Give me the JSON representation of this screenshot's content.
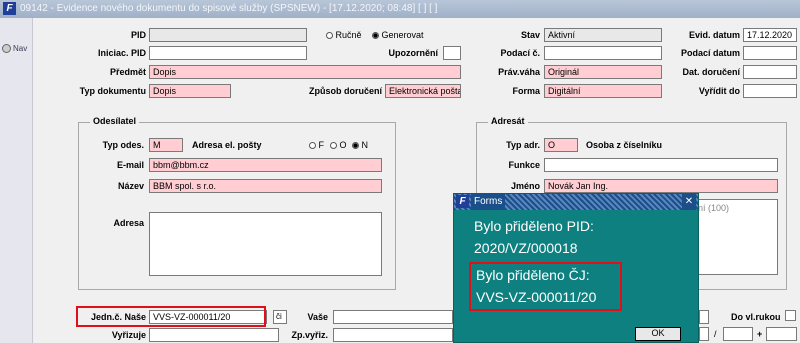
{
  "window": {
    "title": "09142 - Evidence nového dokumentu do spisové služby (SPSNEW) - [17.12.2020; 08:48]  [ ] [ ]"
  },
  "sidebar": {
    "nav_label": "Nav"
  },
  "form": {
    "pid_label": "PID",
    "pid_value": "",
    "rucne_label": "Ručně",
    "generovat_label": "Generovat",
    "stav_label": "Stav",
    "stav_value": "Aktivní",
    "evid_datum_label": "Evid. datum",
    "evid_datum_value": "17.12.2020",
    "iniciac_pid_label": "Iniciac. PID",
    "iniciac_pid_value": "",
    "upozorneni_label": "Upozornění",
    "podaci_c_label": "Podací č.",
    "podaci_c_value": "",
    "podaci_datum_label": "Podací datum",
    "podaci_datum_value": "",
    "predmet_label": "Předmět",
    "predmet_value": "Dopis",
    "prav_vaha_label": "Práv.váha",
    "prav_vaha_value": "Originál",
    "dat_doruceni_label": "Dat. doručení",
    "dat_doruceni_value": "",
    "typ_dokumentu_label": "Typ dokumentu",
    "typ_dokumentu_value": "Dopis",
    "zpusob_doruceni_label": "Způsob doručení",
    "zpusob_doruceni_value": "Elektronická pošta",
    "forma_label": "Forma",
    "forma_value": "Digitální",
    "vyridit_do_label": "Vyřídit do",
    "vyridit_do_value": "",
    "odesilatel": {
      "title": "Odesílatel",
      "typ_odes_label": "Typ odes.",
      "typ_odes_value": "M",
      "adresa_posty_label": "Adresa el. pošty",
      "radio_f": "F",
      "radio_o": "O",
      "radio_n": "N",
      "email_label": "E-mail",
      "email_value": "bbm@bbm.cz",
      "nazev_label": "Název",
      "nazev_value": "BBM spol. s r.o.",
      "adresa_label": "Adresa",
      "adresa_value": ""
    },
    "adresat": {
      "title": "Adresát",
      "typ_adr_label": "Typ adr.",
      "typ_adr_value": "O",
      "osoba_label": "Osoba z číselníku",
      "funkce_label": "Funkce",
      "funkce_value": "",
      "jmeno_label": "Jméno",
      "jmeno_value": "Novák Jan Ing.",
      "partial_text": "ení (100)"
    },
    "jedn_nase_label": "Jedn.č. Naše",
    "jedn_nase_value": "VVS-VZ-000011/20",
    "jedn_btn_label": "či",
    "vase_label": "Vaše",
    "vase_value": "",
    "vyrizuje_label": "Vyřizuje",
    "vyrizuje_value": "",
    "zp_vyriz_label": "Zp.vyřiz.",
    "zp_vyriz_value": "",
    "do_vl_rukou_label": "Do vl.rukou",
    "slash": "/",
    "plus": "+"
  },
  "dialog": {
    "title": "Forms",
    "close_glyph": "✕",
    "msg1_line1": "Bylo přiděleno PID:",
    "msg1_line2": "2020/VZ/000018",
    "msg2_line1": "Bylo přiděleno ČJ:",
    "msg2_line2": "VVS-VZ-000011/20",
    "ok_label": "OK"
  },
  "colors": {
    "required_field": "#ffcdd2",
    "highlight_box": "#e0101b",
    "dialog_bg": "#0e8080"
  }
}
